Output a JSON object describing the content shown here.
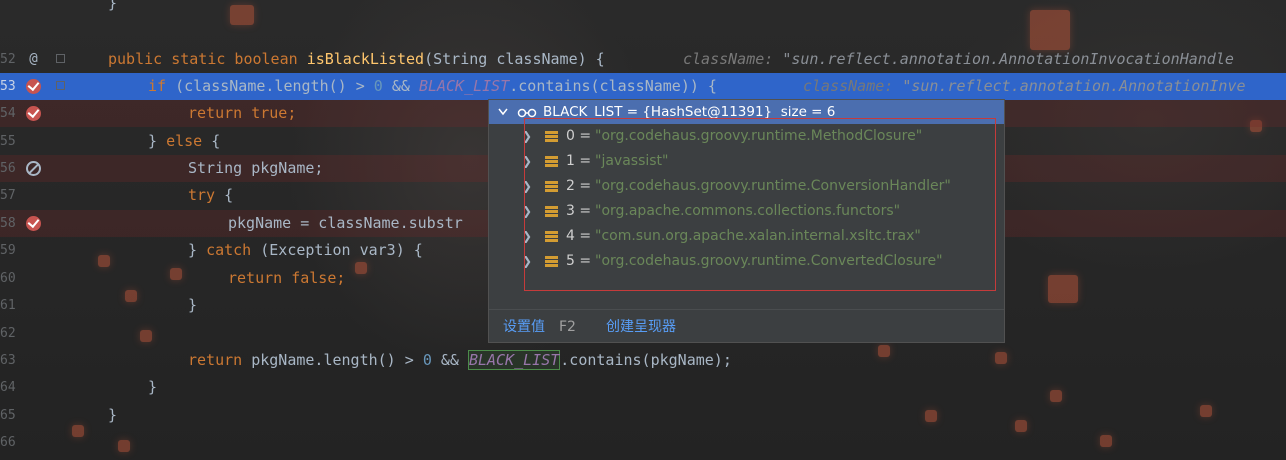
{
  "gutter": {
    "line_numbers": [
      "",
      "52",
      "53",
      "54",
      "55",
      "56",
      "57",
      "58",
      "59",
      "60",
      "61",
      "62",
      "63",
      "64",
      "65",
      "66"
    ]
  },
  "code": {
    "l0": "}",
    "l52_kw1": "public static boolean ",
    "l52_fn": "isBlackListed",
    "l52_rest": "(String className) {",
    "l52_hint_name": "className: ",
    "l52_hint_val": "\"sun.reflect.annotation.AnnotationInvocationHandle",
    "l53_kw": "if ",
    "l53_a": "(className.length() > ",
    "l53_num": "0",
    "l53_b": " && ",
    "l53_const": "BLACK_LIST",
    "l53_c": ".contains(className)) {",
    "l53_hint_name": "className: ",
    "l53_hint_val": "\"sun.reflect.annotation.AnnotationInve",
    "l54_kw": "return true;",
    "l55_a": "} ",
    "l55_kw": "else",
    "l55_b": " {",
    "l56": "String pkgName;",
    "l57_kw": "try",
    "l57_b": " {",
    "l58": "pkgName = className.substr",
    "l59_a": "} ",
    "l59_kw": "catch",
    "l59_b": " (Exception var3) {",
    "l60_kw": "return false;",
    "l61": "}",
    "l63_kw": "return ",
    "l63_a": "pkgName.length() > ",
    "l63_num": "0",
    "l63_b": " && ",
    "l63_const": "BLACK_LIST",
    "l63_c": ".contains(pkgName);",
    "l64": "}",
    "l65": "}"
  },
  "popup": {
    "header": "BLACK_LIST = {HashSet@11391}  size = 6",
    "items": [
      {
        "index": "0 =",
        "value": "\"org.codehaus.groovy.runtime.MethodClosure\""
      },
      {
        "index": "1 =",
        "value": "\"javassist\""
      },
      {
        "index": "2 =",
        "value": "\"org.codehaus.groovy.runtime.ConversionHandler\""
      },
      {
        "index": "3 =",
        "value": "\"org.apache.commons.collections.functors\""
      },
      {
        "index": "4 =",
        "value": "\"com.sun.org.apache.xalan.internal.xsltc.trax\""
      },
      {
        "index": "5 =",
        "value": "\"org.codehaus.groovy.runtime.ConvertedClosure\""
      }
    ],
    "footer_set_value": "设置值",
    "footer_shortcut": "F2",
    "footer_create_renderer": "创建呈现器"
  },
  "colors": {
    "selection": "#2f65ca",
    "popup_header": "#4b6eaf",
    "string": "#6a8759",
    "keyword": "#cc7832",
    "breakpoint": "#c75450",
    "highlight_box": "#c53b3b"
  }
}
